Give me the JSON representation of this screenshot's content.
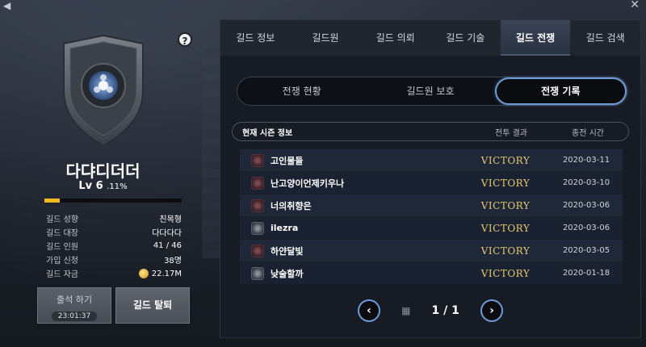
{
  "left": {
    "guild_name": "다댜디더더",
    "level_label": "Lv 6",
    "level_pct": ".11%",
    "xp_fraction": 0.11,
    "help_icon": "?",
    "info": [
      {
        "key": "길드 성향",
        "value": "친목형"
      },
      {
        "key": "길드 대장",
        "value": "다다다다"
      },
      {
        "key": "길드 인원",
        "value": "41 / 46"
      },
      {
        "key": "가입 신청",
        "value": "38명"
      },
      {
        "key": "길드 자금",
        "value": "22.17M"
      }
    ],
    "attend_label": "출석 하기",
    "attend_timer": "23:01:37",
    "leave_label": "길드 탈퇴"
  },
  "tabs": [
    {
      "label": "길드 정보",
      "active": false
    },
    {
      "label": "길드원",
      "active": false
    },
    {
      "label": "길드 의뢰",
      "active": false
    },
    {
      "label": "길드 기술",
      "active": false
    },
    {
      "label": "길드 전쟁",
      "active": true
    },
    {
      "label": "길드 검색",
      "active": false
    }
  ],
  "subtabs": [
    {
      "label": "전쟁 현황",
      "active": false
    },
    {
      "label": "길드원 보호",
      "active": false
    },
    {
      "label": "전쟁 기록",
      "active": true
    }
  ],
  "table": {
    "header_season": "현재 시즌 정보",
    "header_result": "전투 결과",
    "header_time": "종전 시간",
    "rows": [
      {
        "name": "고인물들",
        "result": "VICTORY",
        "date": "2020-03-11",
        "icon": "red-emblem-icon"
      },
      {
        "name": "난고양이언제키우나",
        "result": "VICTORY",
        "date": "2020-03-10",
        "icon": "red-emblem-icon"
      },
      {
        "name": "너의취향은",
        "result": "VICTORY",
        "date": "2020-03-06",
        "icon": "red-emblem-icon"
      },
      {
        "name": "ilezra",
        "result": "VICTORY",
        "date": "2020-03-06",
        "icon": "grey-emblem-icon"
      },
      {
        "name": "하얀달빛",
        "result": "VICTORY",
        "date": "2020-03-05",
        "icon": "red-emblem-icon"
      },
      {
        "name": "낮술할까",
        "result": "VICTORY",
        "date": "2020-01-18",
        "icon": "grey-emblem-icon"
      }
    ]
  },
  "pager": {
    "text": "1 / 1",
    "prev": "‹",
    "next": "›"
  },
  "colors": {
    "accent": "#6f9ad8",
    "victory": "#e4c870",
    "xp": "#f2b820"
  }
}
